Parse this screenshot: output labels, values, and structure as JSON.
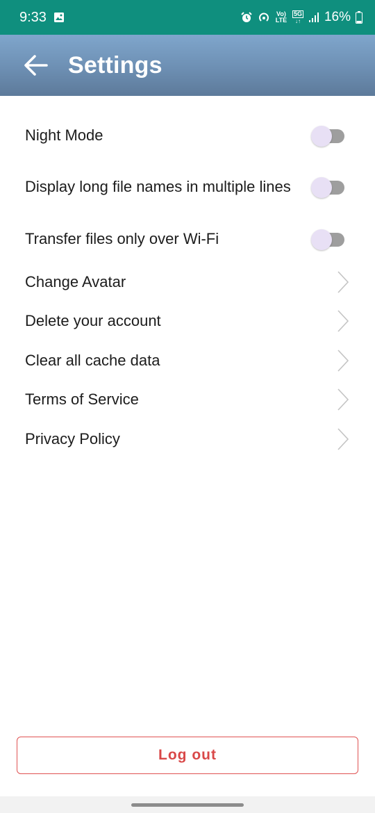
{
  "status_bar": {
    "time": "9:33",
    "battery": "16%",
    "volte_label": "Vo) LTE",
    "network_label": "5G",
    "icons": [
      "image-icon",
      "alarm-icon",
      "hotspot-icon",
      "volte-icon",
      "5g-icon",
      "signal-icon",
      "battery-icon"
    ],
    "background_color": "#0f8f7e"
  },
  "app_bar": {
    "title": "Settings",
    "back_icon": "arrow-left-icon",
    "gradient_colors": [
      "#7fa6cc",
      "#5d7a9a"
    ]
  },
  "settings": {
    "toggles": [
      {
        "label": "Night Mode",
        "on": false
      },
      {
        "label": "Display long file names in multiple lines",
        "on": false
      },
      {
        "label": "Transfer files only over Wi-Fi",
        "on": false
      }
    ],
    "links": [
      {
        "label": "Change Avatar",
        "icon": "chevron-right-icon"
      },
      {
        "label": "Delete your account",
        "icon": "chevron-right-icon"
      },
      {
        "label": "Clear all cache data",
        "icon": "chevron-right-icon"
      },
      {
        "label": "Terms of Service",
        "icon": "chevron-right-icon"
      },
      {
        "label": "Privacy Policy",
        "icon": "chevron-right-icon"
      }
    ]
  },
  "logout": {
    "label": "Log out",
    "accent_color": "#d94848"
  }
}
